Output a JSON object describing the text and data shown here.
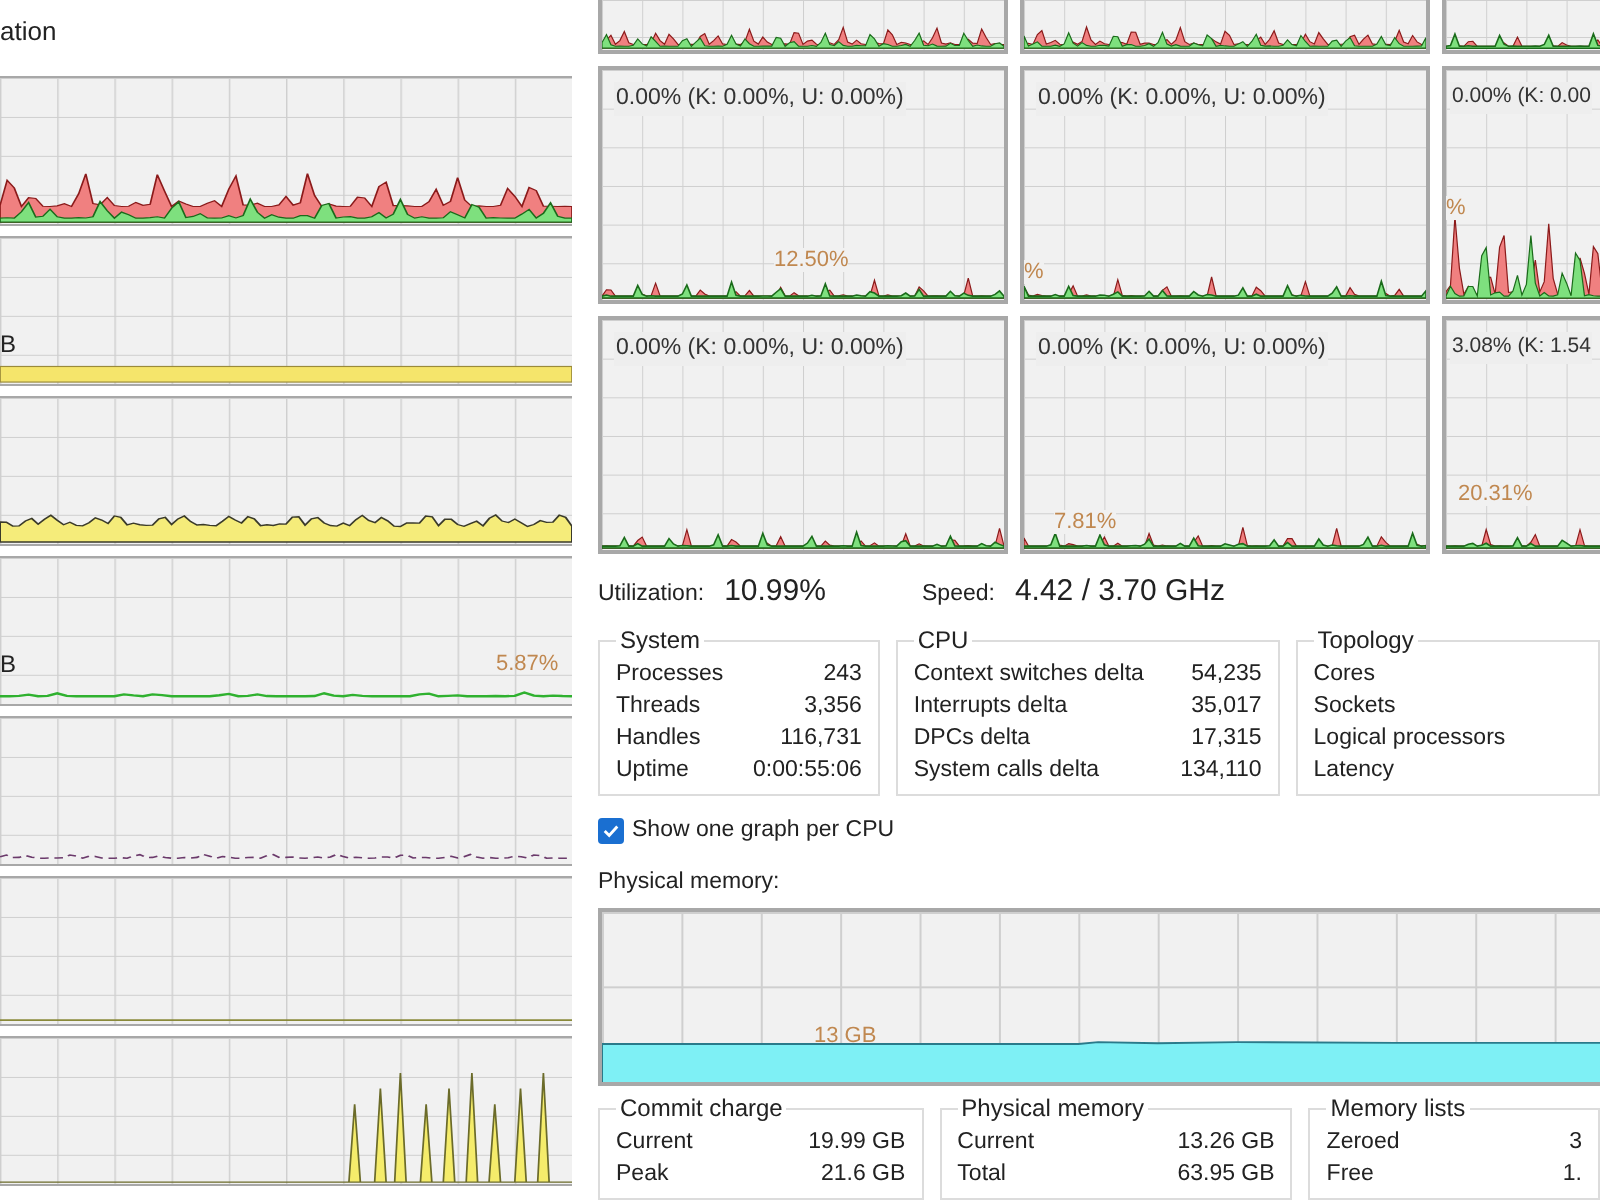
{
  "left_panel": {
    "title": "ation",
    "graphs": [
      {
        "kind": "stacked"
      },
      {
        "kind": "band",
        "label": "B"
      },
      {
        "kind": "wave"
      },
      {
        "kind": "trace",
        "label": "B",
        "peak": "5.87%"
      },
      {
        "kind": "dots"
      },
      {
        "kind": "flat"
      },
      {
        "kind": "spikes"
      }
    ]
  },
  "cpu_graphs": {
    "rows": [
      [
        {
          "kind": "busy"
        },
        {
          "kind": "busy"
        },
        {
          "kind": "quiet"
        }
      ],
      [
        {
          "kind": "quiet",
          "label": "0.00% (K: 0.00%, U: 0.00%)",
          "peak": "12.50%"
        },
        {
          "kind": "quiet",
          "label": "0.00% (K: 0.00%, U: 0.00%)",
          "peak": "%"
        },
        {
          "kind": "busy",
          "label": "0.00% (K: 0.00",
          "peak": "%"
        }
      ],
      [
        {
          "kind": "quiet",
          "label": "0.00% (K: 0.00%, U: 0.00%)"
        },
        {
          "kind": "quiet",
          "label": "0.00% (K: 0.00%, U: 0.00%)",
          "peak": "7.81%"
        },
        {
          "kind": "quiet",
          "label": "3.08% (K: 1.54",
          "peak": "20.31%"
        }
      ]
    ]
  },
  "summary": [
    {
      "label": "Utilization:",
      "value": "10.99%"
    },
    {
      "label": "Speed:",
      "value": "4.42 / 3.70 GHz"
    }
  ],
  "groups": [
    {
      "title": "System",
      "rows": [
        {
          "name": "Processes",
          "value": "243"
        },
        {
          "name": "Threads",
          "value": "3,356"
        },
        {
          "name": "Handles",
          "value": "116,731"
        },
        {
          "name": "Uptime",
          "value": "0:00:55:06"
        }
      ]
    },
    {
      "title": "CPU",
      "rows": [
        {
          "name": "Context switches delta",
          "value": "54,235"
        },
        {
          "name": "Interrupts delta",
          "value": "35,017"
        },
        {
          "name": "DPCs delta",
          "value": "17,315"
        },
        {
          "name": "System calls delta",
          "value": "134,110"
        }
      ]
    },
    {
      "title": "Topology",
      "rows": [
        {
          "name": "Cores"
        },
        {
          "name": "Sockets"
        },
        {
          "name": "Logical processors"
        },
        {
          "name": "Latency"
        }
      ]
    }
  ],
  "checkbox": {
    "label": "Show one graph per CPU",
    "checked": true
  },
  "physical_memory": {
    "title": "Physical memory:",
    "peak": "13 GB"
  },
  "memory_groups": [
    {
      "title": "Commit charge",
      "rows": [
        {
          "name": "Current",
          "value": "19.99 GB"
        },
        {
          "name": "Peak",
          "value": "21.6 GB"
        }
      ]
    },
    {
      "title": "Physical memory",
      "rows": [
        {
          "name": "Current",
          "value": "13.26 GB"
        },
        {
          "name": "Total",
          "value": "63.95 GB"
        }
      ]
    },
    {
      "title": "Memory lists",
      "rows": [
        {
          "name": "Zeroed",
          "value": "3"
        },
        {
          "name": "Free",
          "value": "1."
        }
      ]
    }
  ]
}
